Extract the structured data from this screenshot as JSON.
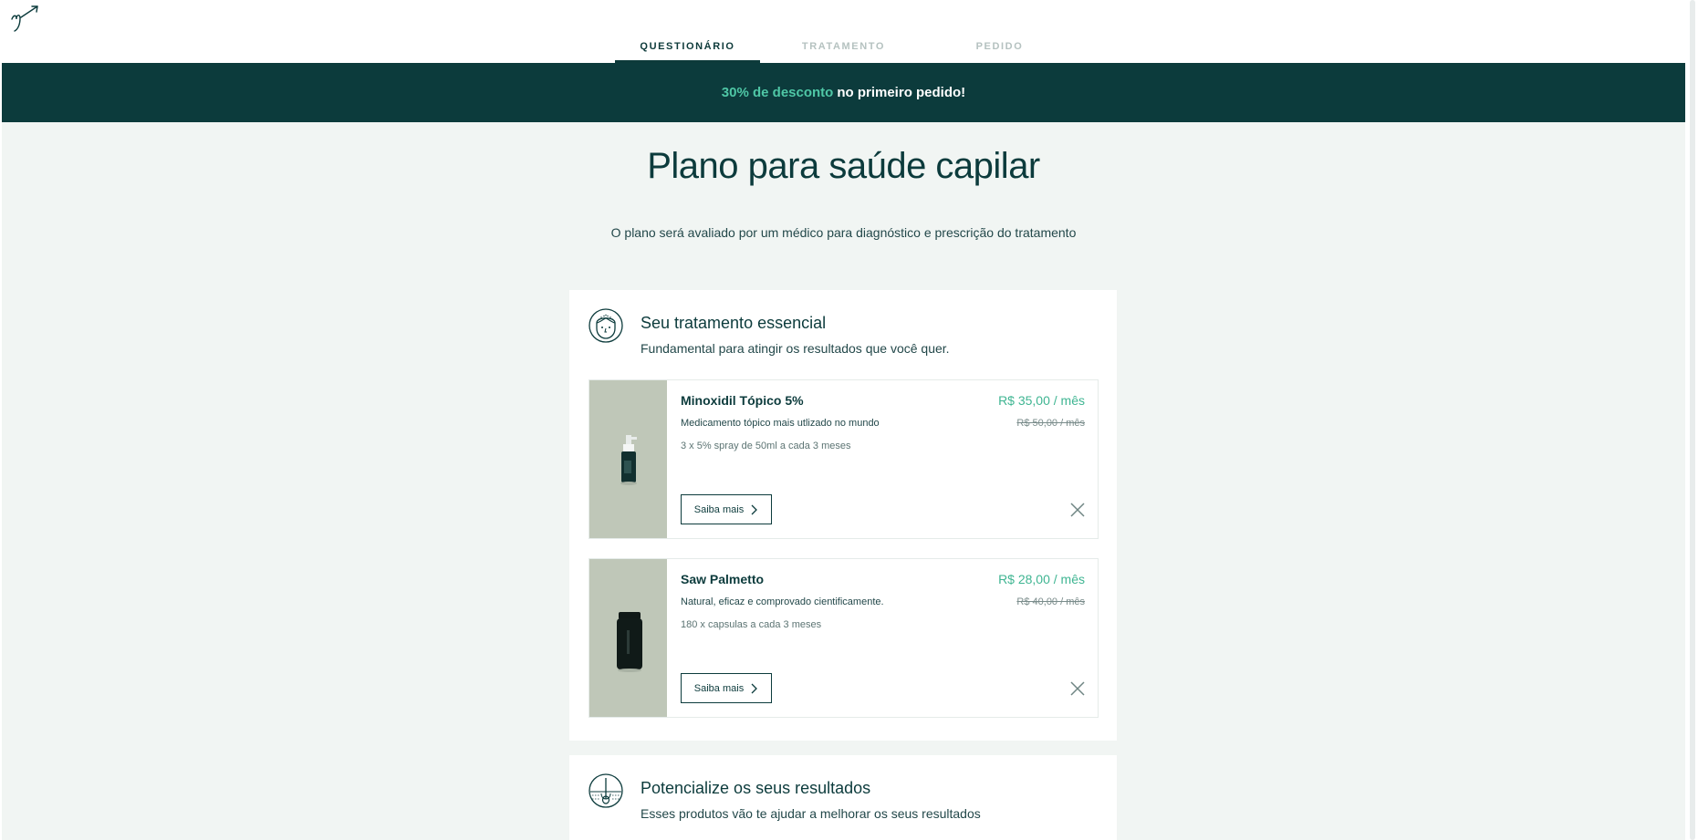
{
  "header": {
    "tabs": [
      {
        "label": "QUESTIONÁRIO",
        "active": true
      },
      {
        "label": "TRATAMENTO",
        "active": false
      },
      {
        "label": "PEDIDO",
        "active": false
      }
    ]
  },
  "promo": {
    "highlight": "30% de desconto",
    "text": "no primeiro pedido!"
  },
  "page": {
    "title": "Plano para saúde capilar",
    "subtitle": "O plano será avaliado por um médico para diagnóstico e prescrição do tratamento"
  },
  "sections": [
    {
      "title": "Seu tratamento essencial",
      "subtitle": "Fundamental para atingir os resultados que você quer.",
      "icon": "face-icon",
      "products": [
        {
          "name": "Minoxidil Tópico 5%",
          "description": "Medicamento tópico mais utlizado no mundo",
          "quantity": "3 x 5% spray de 50ml a cada 3 meses",
          "price": "R$ 35,00 / mês",
          "old_price": "R$ 50,00 / mês",
          "button": "Saiba mais",
          "image": "spray-bottle"
        },
        {
          "name": "Saw Palmetto",
          "description": "Natural, eficaz e comprovado cientificamente.",
          "quantity": "180 x capsulas a cada 3 meses",
          "price": "R$ 28,00 / mês",
          "old_price": "R$ 40,00 / mês",
          "button": "Saiba mais",
          "image": "capsule-jar"
        }
      ]
    },
    {
      "title": "Potencialize os seus resultados",
      "subtitle": "Esses produtos vão te ajudar a melhorar os seus resultados",
      "icon": "hair-follicle-icon"
    }
  ],
  "colors": {
    "brand_dark": "#0c3b3c",
    "accent_green": "#4fc7a6",
    "price_green": "#3fb592",
    "background": "#f1f5f3",
    "product_bg": "#bfc7b8"
  }
}
